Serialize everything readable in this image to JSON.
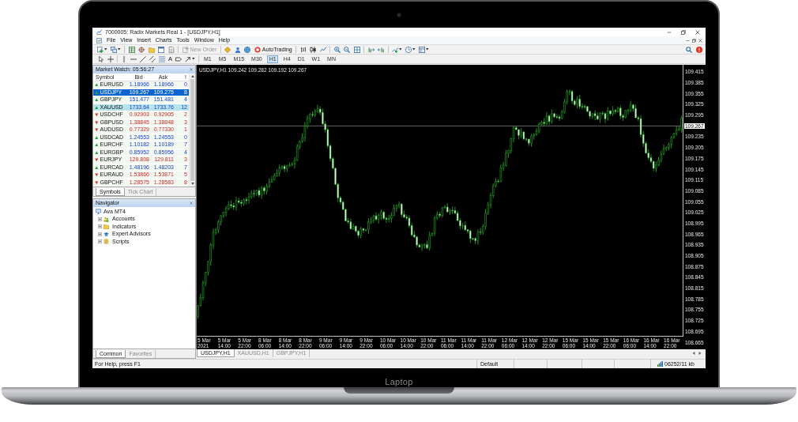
{
  "window": {
    "title": "7000005: Radix Markets Real 1 - [USDJPY,H1]"
  },
  "menu": [
    "File",
    "View",
    "Insert",
    "Charts",
    "Tools",
    "Window",
    "Help"
  ],
  "toolbar": {
    "new_order": {
      "label": "New Order",
      "disabled": true
    },
    "autotrading": {
      "label": "AutoTrading",
      "on": false
    }
  },
  "drawing_toolbar": {
    "text_tool": "A",
    "timeframes": [
      {
        "label": "M1",
        "selected": false
      },
      {
        "label": "M5",
        "selected": false
      },
      {
        "label": "M15",
        "selected": false
      },
      {
        "label": "M30",
        "selected": false
      },
      {
        "label": "H1",
        "selected": true
      },
      {
        "label": "H4",
        "selected": false
      },
      {
        "label": "D1",
        "selected": false
      },
      {
        "label": "W1",
        "selected": false
      },
      {
        "label": "MN",
        "selected": false
      }
    ]
  },
  "market_watch": {
    "title": "Market Watch: 05:56:27",
    "columns": [
      "Symbol",
      "Bid",
      "Ask",
      "!"
    ],
    "rows": [
      {
        "symbol": "EURUSD",
        "bid": "1.18966",
        "ask": "1.18966",
        "spread": "0",
        "rising": true,
        "selected": false,
        "highlighted": false
      },
      {
        "symbol": "USDJPY",
        "bid": "109.267",
        "ask": "109.275",
        "spread": "8",
        "rising": true,
        "selected": true,
        "highlighted": false
      },
      {
        "symbol": "GBPJPY",
        "bid": "151.477",
        "ask": "151.481",
        "spread": "4",
        "rising": true,
        "selected": false,
        "highlighted": false
      },
      {
        "symbol": "XAUUSD",
        "bid": "1733.64",
        "ask": "1733.76",
        "spread": "12",
        "rising": true,
        "selected": false,
        "highlighted": true
      },
      {
        "symbol": "USDCHF",
        "bid": "0.92903",
        "ask": "0.92905",
        "spread": "2",
        "rising": false,
        "selected": false,
        "highlighted": false
      },
      {
        "symbol": "GBPUSD",
        "bid": "1.38845",
        "ask": "1.38848",
        "spread": "3",
        "rising": false,
        "selected": false,
        "highlighted": false
      },
      {
        "symbol": "AUDUSD",
        "bid": "0.77329",
        "ask": "0.77330",
        "spread": "1",
        "rising": false,
        "selected": false,
        "highlighted": false
      },
      {
        "symbol": "USDCAD",
        "bid": "1.24553",
        "ask": "1.24553",
        "spread": "0",
        "rising": true,
        "selected": false,
        "highlighted": false
      },
      {
        "symbol": "EURCHF",
        "bid": "1.10182",
        "ask": "1.10189",
        "spread": "7",
        "rising": true,
        "selected": false,
        "highlighted": false
      },
      {
        "symbol": "EURGBP",
        "bid": "0.85952",
        "ask": "0.85956",
        "spread": "4",
        "rising": true,
        "selected": false,
        "highlighted": false
      },
      {
        "symbol": "EURJPY",
        "bid": "129.808",
        "ask": "129.811",
        "spread": "3",
        "rising": false,
        "selected": false,
        "highlighted": false
      },
      {
        "symbol": "EURCAD",
        "bid": "1.48196",
        "ask": "1.48203",
        "spread": "7",
        "rising": true,
        "selected": false,
        "highlighted": false
      },
      {
        "symbol": "EURAUD",
        "bid": "1.53866",
        "ask": "1.53871",
        "spread": "5",
        "rising": false,
        "selected": false,
        "highlighted": false
      },
      {
        "symbol": "GBPCHF",
        "bid": "1.28575",
        "ask": "1.28583",
        "spread": "8",
        "rising": false,
        "selected": false,
        "highlighted": false
      }
    ],
    "tabs": [
      {
        "label": "Symbols",
        "selected": true
      },
      {
        "label": "Tick Chart",
        "selected": false
      }
    ]
  },
  "navigator": {
    "title": "Navigator",
    "tree": [
      {
        "label": "Ava MT4",
        "kind": "terminal",
        "children": [
          {
            "label": "Accounts",
            "kind": "accounts",
            "expanded": false
          },
          {
            "label": "Indicators",
            "kind": "indicators",
            "expanded": false
          },
          {
            "label": "Expert Advisors",
            "kind": "experts",
            "expanded": false
          },
          {
            "label": "Scripts",
            "kind": "scripts",
            "expanded": false
          }
        ]
      }
    ],
    "tabs": [
      {
        "label": "Common",
        "selected": true
      },
      {
        "label": "Favorites",
        "selected": false
      }
    ]
  },
  "chart": {
    "header": "USDJPY,H1 109.242 109.282 109.192 109.267",
    "price_axis": [
      {
        "text": "109.415",
        "kind": "tick"
      },
      {
        "text": "109.385",
        "kind": "tick"
      },
      {
        "text": "109.355",
        "kind": "tick"
      },
      {
        "text": "109.325",
        "kind": "tick"
      },
      {
        "text": "109.295",
        "kind": "tick"
      },
      {
        "text": "109.267",
        "kind": "current"
      },
      {
        "text": "109.235",
        "kind": "tick"
      },
      {
        "text": "109.205",
        "kind": "tick"
      },
      {
        "text": "109.175",
        "kind": "tick"
      },
      {
        "text": "109.145",
        "kind": "tick"
      },
      {
        "text": "109.115",
        "kind": "tick"
      },
      {
        "text": "109.085",
        "kind": "tick"
      },
      {
        "text": "109.055",
        "kind": "tick"
      },
      {
        "text": "109.025",
        "kind": "tick"
      },
      {
        "text": "108.995",
        "kind": "tick"
      },
      {
        "text": "108.965",
        "kind": "tick"
      },
      {
        "text": "108.935",
        "kind": "tick"
      },
      {
        "text": "108.905",
        "kind": "tick"
      },
      {
        "text": "108.875",
        "kind": "tick"
      },
      {
        "text": "108.845",
        "kind": "tick"
      },
      {
        "text": "108.815",
        "kind": "tick"
      },
      {
        "text": "108.785",
        "kind": "tick"
      },
      {
        "text": "108.755",
        "kind": "tick"
      },
      {
        "text": "108.725",
        "kind": "tick"
      },
      {
        "text": "108.695",
        "kind": "tick"
      },
      {
        "text": "108.665",
        "kind": "tick"
      }
    ],
    "time_axis": [
      "5 Mar 2021",
      "5 Mar 14:00",
      "5 Mar 22:00",
      "8 Mar 06:00",
      "8 Mar 14:00",
      "8 Mar 22:00",
      "9 Mar 06:00",
      "9 Mar 14:00",
      "9 Mar 22:00",
      "10 Mar 06:00",
      "10 Mar 14:00",
      "10 Mar 22:00",
      "11 Mar 06:00",
      "11 Mar 14:00",
      "11 Mar 22:00",
      "12 Mar 06:00",
      "12 Mar 14:00",
      "12 Mar 22:00",
      "15 Mar 06:00",
      "15 Mar 14:00",
      "15 Mar 22:00",
      "16 Mar 06:00",
      "16 Mar 14:00",
      "16 Mar 22:00"
    ],
    "tabs": [
      {
        "label": "USDJPY,H1",
        "selected": true
      },
      {
        "label": "XAUUSD,H1",
        "selected": false
      },
      {
        "label": "GBPJPY,H1",
        "selected": false
      }
    ]
  },
  "status_bar": {
    "help": "For Help, press F1",
    "profile": "Default",
    "traffic": "06252/11 kb"
  },
  "device": {
    "label": "Laptop"
  }
}
